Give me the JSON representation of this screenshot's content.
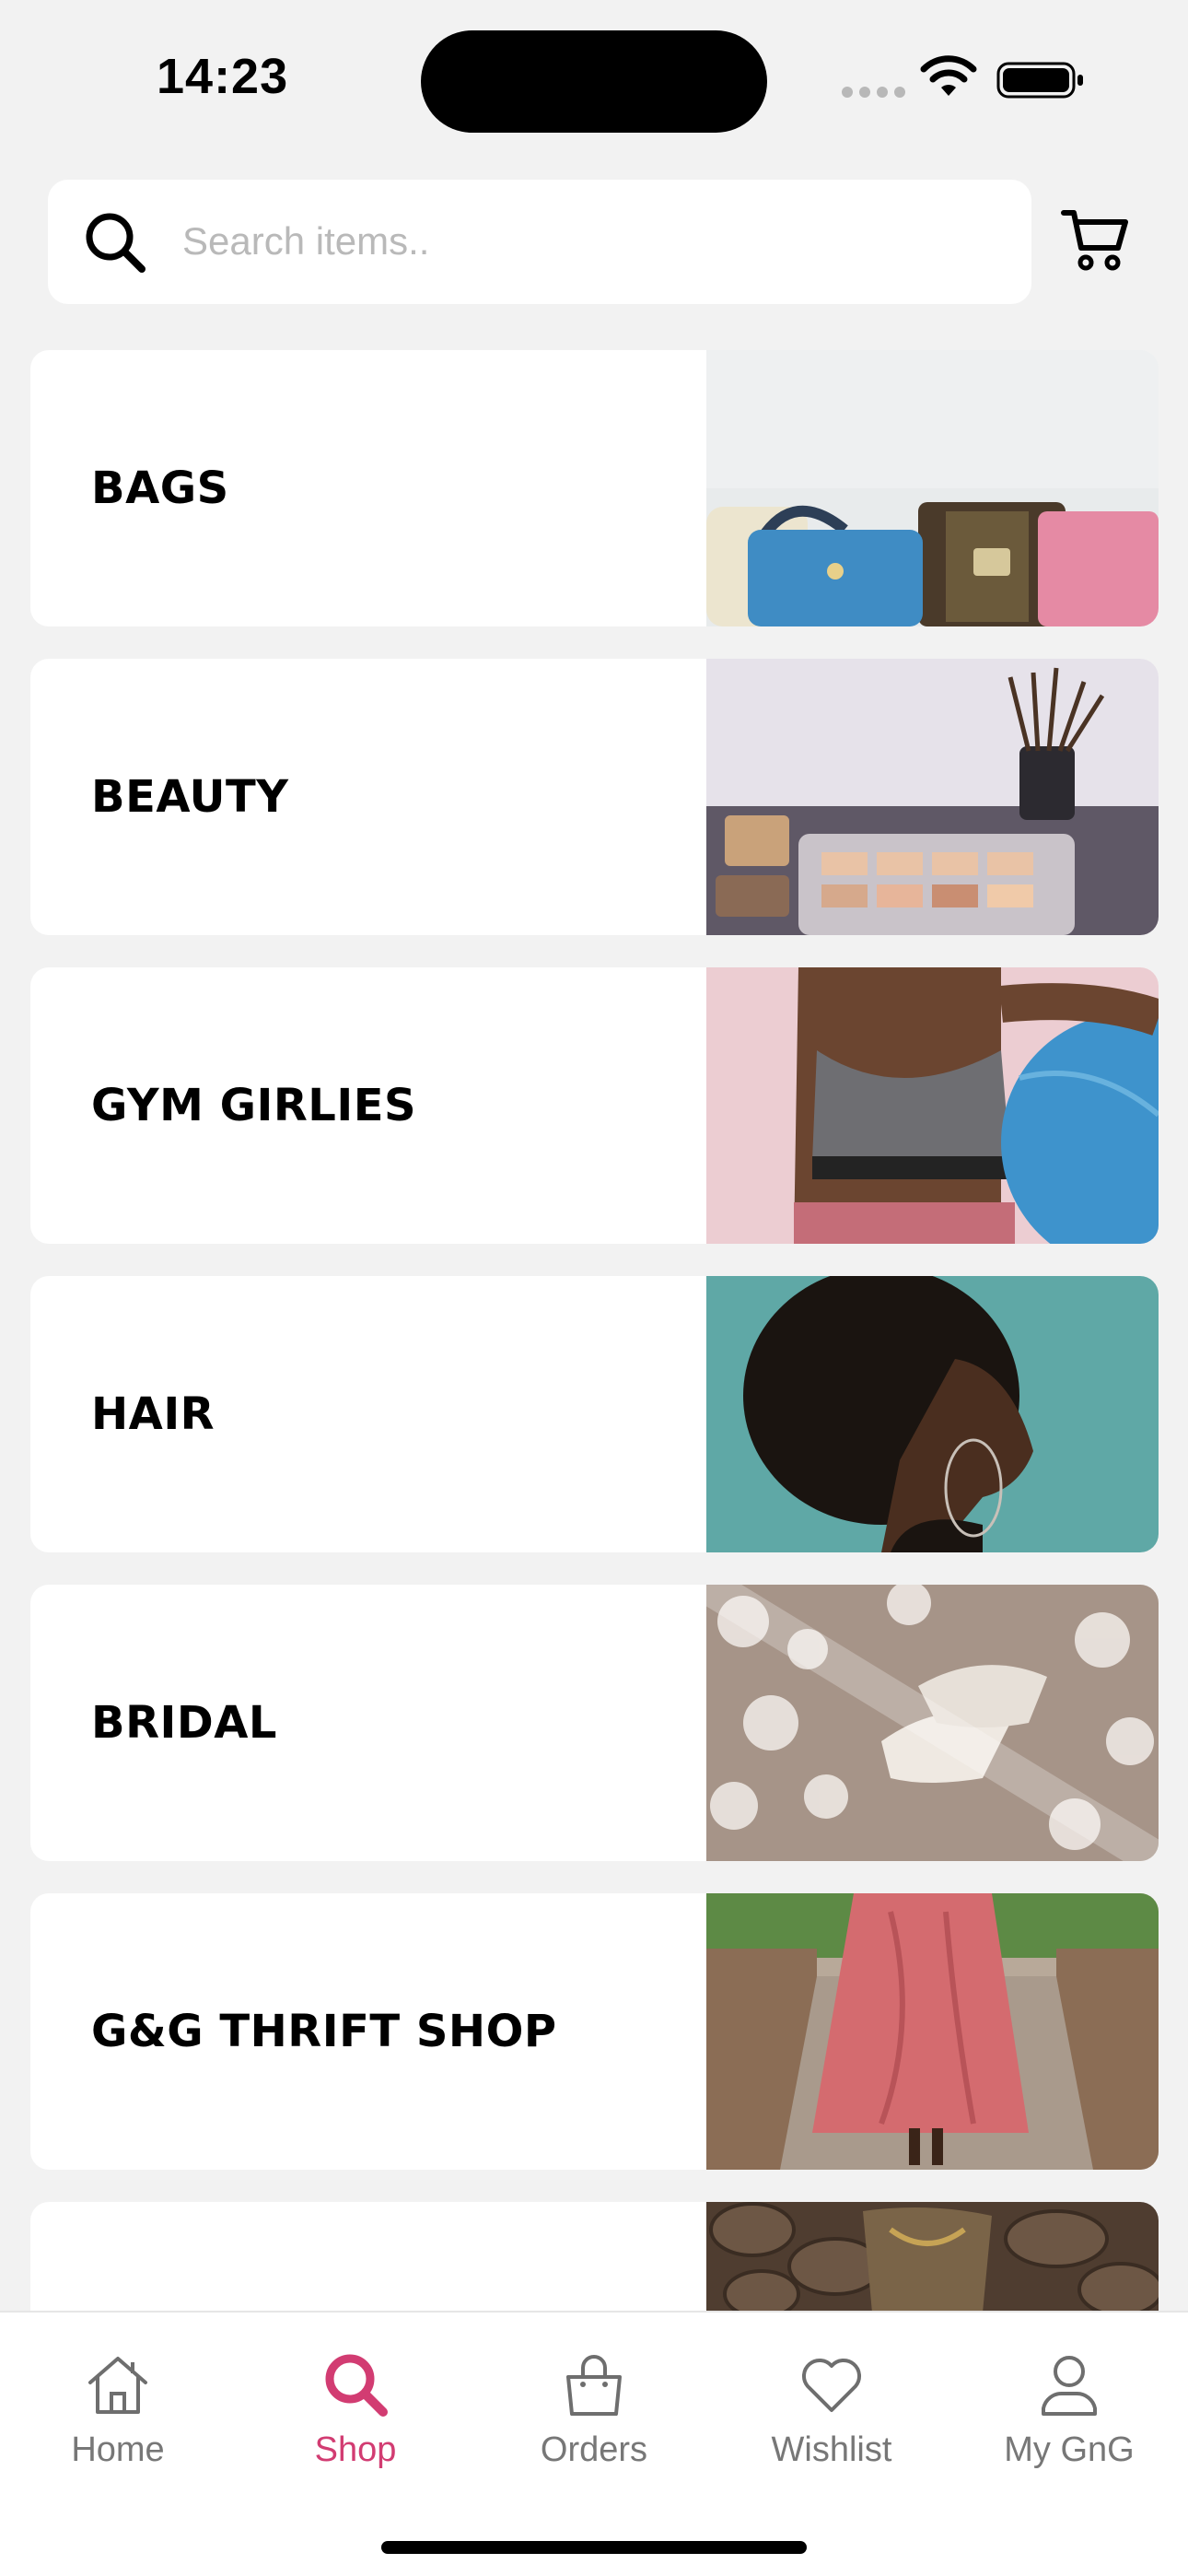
{
  "status_bar": {
    "time": "14:23"
  },
  "search": {
    "placeholder": "Search items.."
  },
  "categories": [
    {
      "label": "BAGS",
      "image": "handbags-photo"
    },
    {
      "label": "BEAUTY",
      "image": "makeup-palette-brushes-photo"
    },
    {
      "label": "GYM GIRLIES",
      "image": "sports-bra-exercise-ball-photo"
    },
    {
      "label": "HAIR",
      "image": "afro-hair-profile-photo"
    },
    {
      "label": "BRIDAL",
      "image": "lace-veil-bridal-shoes-photo"
    },
    {
      "label": "G&G THRIFT SHOP",
      "image": "pink-satin-skirt-photo"
    },
    {
      "label": "",
      "image": "stone-wall-boots-photo"
    }
  ],
  "nav": {
    "items": [
      {
        "label": "Home",
        "icon": "home-icon"
      },
      {
        "label": "Shop",
        "icon": "search-icon",
        "active": true
      },
      {
        "label": "Orders",
        "icon": "bag-icon"
      },
      {
        "label": "Wishlist",
        "icon": "heart-icon"
      },
      {
        "label": "My GnG",
        "icon": "user-icon"
      }
    ]
  },
  "colors": {
    "accent": "#d23c72",
    "background": "#f2f2f2",
    "inactive": "#777777"
  }
}
